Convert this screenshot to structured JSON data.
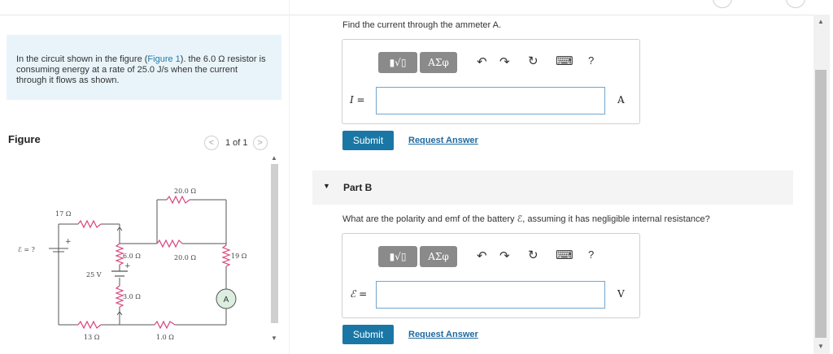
{
  "problem": {
    "text_before_link": "In the circuit shown in the figure (",
    "figure_link": "Figure 1",
    "text_after_link": "). the 6.0 Ω resistor is consuming energy at a rate of 25.0 J/s when the current through it flows as shown."
  },
  "figure": {
    "title": "Figure",
    "pager": {
      "current": "1 of 1",
      "prev": "<",
      "next": ">"
    },
    "circuit_labels": {
      "emf": "ℰ = ?",
      "plus_top": "+",
      "plus_25v": "+",
      "r17": "17 Ω",
      "r6": "6.0 Ω",
      "r20_top": "20.0 Ω",
      "r20_mid": "20.0 Ω",
      "r19": "19 Ω",
      "v25": "25 V",
      "r3": "3.0 Ω",
      "r13": "13 Ω",
      "r1": "1.0 Ω",
      "ammeter": "A"
    }
  },
  "partA": {
    "question": "Find the current through the ammeter A.",
    "toolbar": {
      "template": "▮√▯",
      "greek": "ΑΣφ",
      "undo": "↶",
      "redo": "↷",
      "reset": "↻",
      "keyboard": "⌨",
      "help": "?"
    },
    "variable": "I =",
    "input_value": "",
    "unit": "A",
    "submit": "Submit",
    "request": "Request Answer"
  },
  "partB": {
    "header": "Part B",
    "question": "What are the polarity and emf of the battery ℰ, assuming it has negligible internal resistance?",
    "toolbar": {
      "template": "▮√▯",
      "greek": "ΑΣφ",
      "undo": "↶",
      "redo": "↷",
      "reset": "↻",
      "keyboard": "⌨",
      "help": "?"
    },
    "variable": "ℰ =",
    "input_value": "",
    "unit": "V",
    "submit": "Submit",
    "request": "Request Answer"
  },
  "colors": {
    "accent": "#1a77a5",
    "problem_bg": "#e9f4fa",
    "resistor_pink": "#d9447c",
    "wire": "#555555",
    "ammeter_fill": "#dbeee0"
  },
  "icons": {
    "collapse": "▼",
    "scroll_up": "▲",
    "scroll_down": "▼"
  }
}
